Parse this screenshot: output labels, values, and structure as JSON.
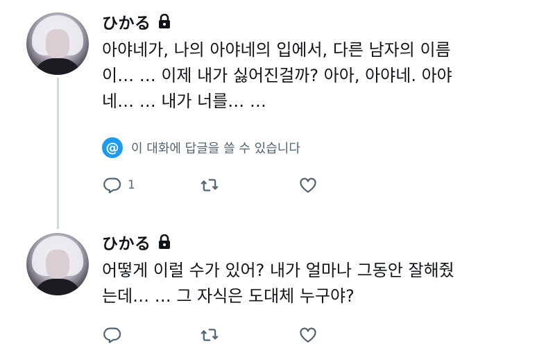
{
  "tweets": [
    {
      "username": "ひかる",
      "text": "아야네가, 나의 아야네의 입에서, 다른 남자의 이름\n이… … 이제 내가 싫어진걸까? 아아, 아야네. 아야\n네… … 내가 너를… …",
      "reply_restriction": "이 대화에 답글을 쓸 수 있습니다",
      "reply_count": "1"
    },
    {
      "username": "ひかる",
      "text": "어떻게 이럴 수가 있어? 내가 얼마나 그동안 잘해줬\n는데… … 그 자식은 도대체 누구야?"
    }
  ],
  "icons": {
    "reply": "reply-icon",
    "retweet": "retweet-icon",
    "like": "like-icon",
    "lock": "lock-icon",
    "mention": "at-icon"
  },
  "colors": {
    "accent": "#1d9bf0",
    "muted": "#536471",
    "thread_line": "#cfd9de"
  }
}
